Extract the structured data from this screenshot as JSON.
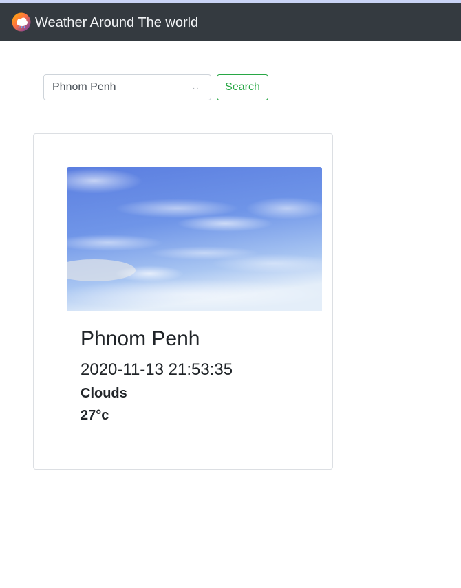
{
  "navbar": {
    "title": "Weather Around The world",
    "logo_icon": "weather-logo-icon"
  },
  "search": {
    "value": "Phnom Penh",
    "button_label": "Search",
    "button_color": "#28a745"
  },
  "weather_card": {
    "image_icon": "sky-clouds-image",
    "city": "Phnom Penh",
    "datetime": "2020-11-13 21:53:35",
    "condition": "Clouds",
    "temperature": "27°c"
  },
  "colors": {
    "navbar_bg": "#343a40",
    "accent": "#28a745"
  }
}
